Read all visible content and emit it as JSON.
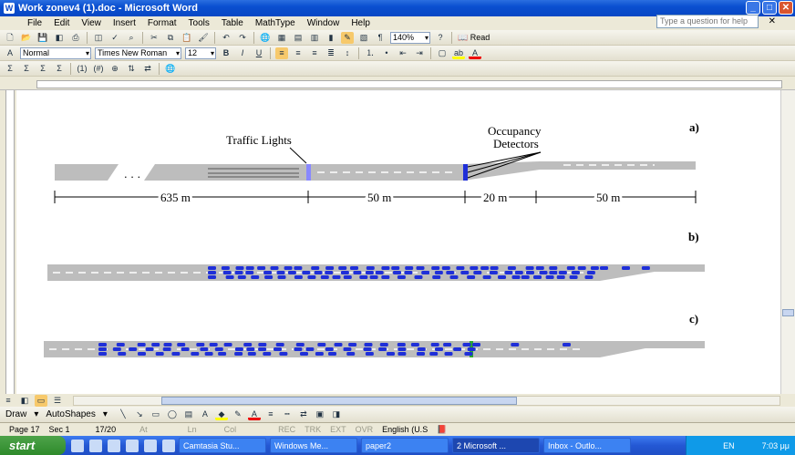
{
  "window": {
    "title": "Work zonev4 (1).doc - Microsoft Word"
  },
  "menu": {
    "items": [
      "File",
      "Edit",
      "View",
      "Insert",
      "Format",
      "Tools",
      "Table",
      "MathType",
      "Window",
      "Help"
    ],
    "help_placeholder": "Type a question for help"
  },
  "toolbar": {
    "zoom": "140%",
    "read_label": "Read",
    "style": "Normal",
    "font": "Times New Roman",
    "size": "12",
    "bold": "B",
    "italic": "I",
    "underline": "U"
  },
  "figure": {
    "panel_a": {
      "label": "a)",
      "traffic_lights": "Traffic Lights",
      "occupancy_line1": "Occupancy",
      "occupancy_line2": "Detectors",
      "ellipsis": ". . .",
      "dim1": "635 m",
      "dim2": "50 m",
      "dim3": "20 m",
      "dim4": "50 m"
    },
    "panel_b": {
      "label": "b)"
    },
    "panel_c": {
      "label": "c)"
    },
    "colors": {
      "road": "#bdbdbd",
      "car": "#1f2fd8",
      "light": "#8888ff"
    }
  },
  "drawbar": {
    "draw": "Draw",
    "autoshapes": "AutoShapes"
  },
  "status": {
    "page": "Page 17",
    "sec": "Sec 1",
    "pages": "17/20",
    "at": "At",
    "ln": "Ln",
    "col": "Col",
    "rec": "REC",
    "trk": "TRK",
    "ext": "EXT",
    "ovr": "OVR",
    "lang": "English (U.S"
  },
  "taskbar": {
    "start": "start",
    "tasks": [
      "Camtasia Stu...",
      "Windows Me...",
      "paper2",
      "2 Microsoft ...",
      "Inbox - Outlo..."
    ],
    "lang": "EN",
    "time": "7:03 μμ"
  }
}
